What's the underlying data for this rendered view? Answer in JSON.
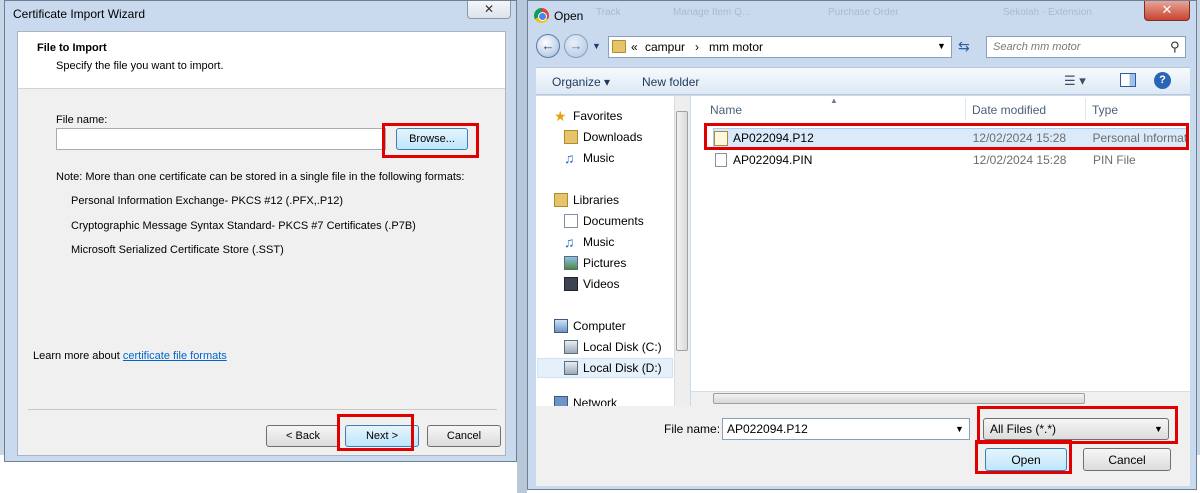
{
  "wizard": {
    "title": "Certificate Import Wizard",
    "close_glyph": "✕",
    "section_title": "File to Import",
    "section_subtitle": "Specify the file you want to import.",
    "file_name_label": "File name:",
    "browse_label": "Browse...",
    "note": "Note:  More than one certificate can be stored in a single file in the following formats:",
    "formats": [
      "Personal Information Exchange- PKCS #12 (.PFX,.P12)",
      "Cryptographic Message Syntax Standard- PKCS #7 Certificates (.P7B)",
      "Microsoft Serialized Certificate Store (.SST)"
    ],
    "learn_prefix": "Learn more about ",
    "learn_link": "certificate file formats",
    "back_label": "< Back",
    "next_label": "Next >",
    "cancel_label": "Cancel"
  },
  "open_dialog": {
    "title": "Open",
    "close_glyph": "✕",
    "background_tabs": [
      "Track",
      "Manage Item Q...",
      "Purchase Order",
      "Sekolah - Extension"
    ],
    "address_parts": [
      "«",
      "campur",
      "›",
      "mm motor"
    ],
    "search_placeholder": "Search mm motor",
    "toolbar": {
      "organize": "Organize ▾",
      "new_folder": "New folder"
    },
    "nav": {
      "favorites": "Favorites",
      "downloads": "Downloads",
      "music": "Music",
      "libraries": "Libraries",
      "documents": "Documents",
      "music2": "Music",
      "pictures": "Pictures",
      "videos": "Videos",
      "computer": "Computer",
      "disk_c": "Local Disk (C:)",
      "disk_d": "Local Disk (D:)",
      "network": "Network"
    },
    "columns": {
      "name": "Name",
      "date": "Date modified",
      "type": "Type"
    },
    "files": [
      {
        "name": "AP022094.P12",
        "date": "12/02/2024 15:28",
        "type": "Personal Informat"
      },
      {
        "name": "AP022094.PIN",
        "date": "12/02/2024 15:28",
        "type": "PIN File"
      }
    ],
    "file_name_label": "File name:",
    "file_name_value": "AP022094.P12",
    "filter_value": "All Files (*.*)",
    "open_label": "Open",
    "cancel_label": "Cancel"
  },
  "colors": {
    "highlight": "#e00000",
    "window_frame": "#c9daee",
    "link": "#0066cc",
    "selection": "#dbeafb"
  }
}
